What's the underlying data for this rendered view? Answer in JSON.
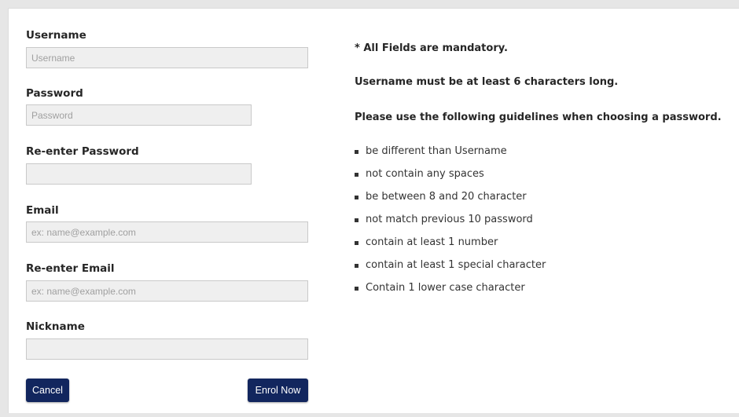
{
  "form": {
    "username": {
      "label": "Username",
      "placeholder": "Username",
      "value": ""
    },
    "password": {
      "label": "Password",
      "placeholder": "Password",
      "value": ""
    },
    "reenter_password": {
      "label": "Re-enter Password",
      "placeholder": "",
      "value": ""
    },
    "email": {
      "label": "Email",
      "placeholder": "ex: name@example.com",
      "value": ""
    },
    "reenter_email": {
      "label": "Re-enter Email",
      "placeholder": "ex: name@example.com",
      "value": ""
    },
    "nickname": {
      "label": "Nickname",
      "placeholder": "",
      "value": ""
    }
  },
  "buttons": {
    "cancel": "Cancel",
    "enrol": "Enrol Now"
  },
  "info": {
    "mandatory": "* All Fields are mandatory.",
    "username_rule": "Username must be at least 6 characters long.",
    "guidelines_intro": "Please use the following guidelines when choosing a password.",
    "rules": [
      "be different than Username",
      "not contain any spaces",
      "be between 8 and 20 character",
      "not match previous 10 password",
      "contain at least 1 number",
      "contain at least 1 special character",
      "Contain 1 lower case character"
    ]
  },
  "colors": {
    "button_bg": "#12265e",
    "input_bg": "#efefef",
    "page_bg": "#e6e6e6"
  }
}
